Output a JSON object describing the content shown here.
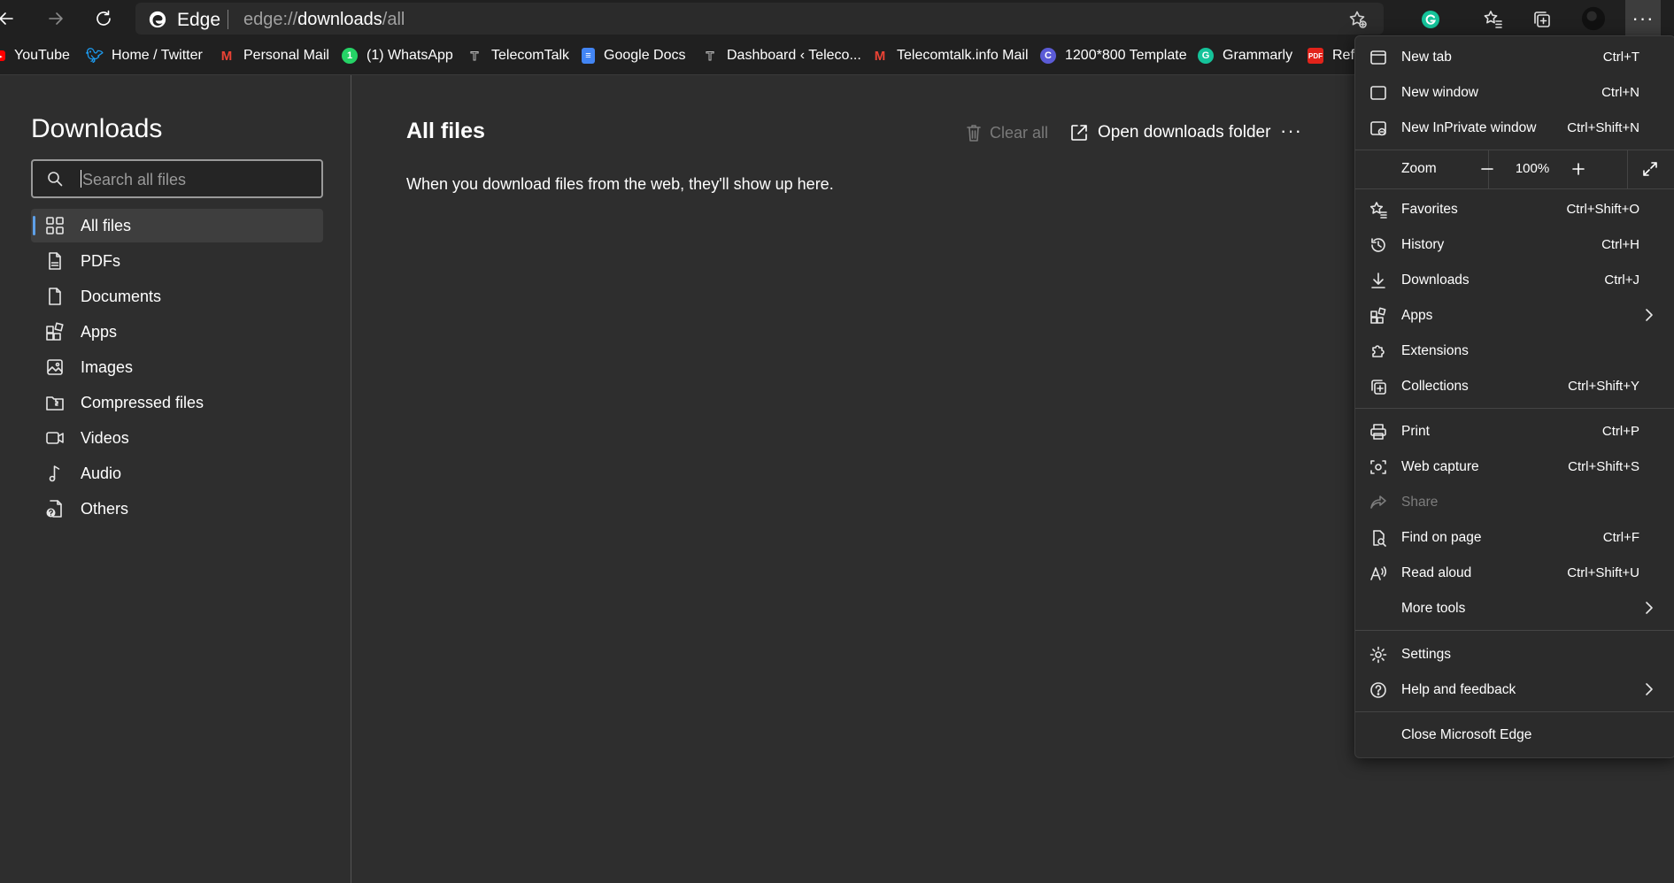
{
  "browser": {
    "name": "Edge",
    "url_prefix": "edge://",
    "url_main": "downloads",
    "url_suffix": "/all",
    "menu_button": "···"
  },
  "bookmarks": [
    {
      "label": "YouTube",
      "icon": "youtube-icon",
      "color": "#ff0000"
    },
    {
      "label": "Home / Twitter",
      "icon": "twitter-icon",
      "color": "#1d9bf0"
    },
    {
      "label": "Personal Mail",
      "icon": "gmail-icon",
      "color": "#ea4335"
    },
    {
      "label": "(1) WhatsApp",
      "icon": "whatsapp-icon",
      "color": "#25d366"
    },
    {
      "label": "TelecomTalk",
      "icon": "telecomtalk-icon",
      "color": "#000000"
    },
    {
      "label": "Google Docs",
      "icon": "google-docs-icon",
      "color": "#4285f4"
    },
    {
      "label": "Dashboard ‹ Teleco...",
      "icon": "telecomtalk-icon",
      "color": "#000000"
    },
    {
      "label": "Telecomtalk.info Mail",
      "icon": "gmail-icon",
      "color": "#ea4335"
    },
    {
      "label": "1200*800 Template",
      "icon": "canva-icon",
      "color": "#5b5bd6"
    },
    {
      "label": "Grammarly",
      "icon": "grammarly-icon",
      "color": "#15c39a"
    },
    {
      "label": "Refe",
      "icon": "pdf-icon",
      "color": "#e2231a"
    }
  ],
  "sidebar": {
    "title": "Downloads",
    "search_placeholder": "Search all files",
    "items": [
      {
        "label": "All files",
        "icon": "grid-icon"
      },
      {
        "label": "PDFs",
        "icon": "pdf-file-icon"
      },
      {
        "label": "Documents",
        "icon": "document-icon"
      },
      {
        "label": "Apps",
        "icon": "apps-icon"
      },
      {
        "label": "Images",
        "icon": "image-icon"
      },
      {
        "label": "Compressed files",
        "icon": "archive-icon"
      },
      {
        "label": "Videos",
        "icon": "video-icon"
      },
      {
        "label": "Audio",
        "icon": "music-note-icon"
      },
      {
        "label": "Others",
        "icon": "unknown-file-icon"
      }
    ]
  },
  "main": {
    "title": "All files",
    "clear_all": "Clear all",
    "open_folder": "Open downloads folder",
    "more": "···",
    "empty_message": "When you download files from the web, they'll show up here."
  },
  "menu": {
    "new_tab": {
      "label": "New tab",
      "shortcut": "Ctrl+T"
    },
    "new_window": {
      "label": "New window",
      "shortcut": "Ctrl+N"
    },
    "new_inprivate": {
      "label": "New InPrivate window",
      "shortcut": "Ctrl+Shift+N"
    },
    "zoom": {
      "label": "Zoom",
      "value": "100%"
    },
    "favorites": {
      "label": "Favorites",
      "shortcut": "Ctrl+Shift+O"
    },
    "history": {
      "label": "History",
      "shortcut": "Ctrl+H"
    },
    "downloads": {
      "label": "Downloads",
      "shortcut": "Ctrl+J"
    },
    "apps": {
      "label": "Apps"
    },
    "extensions": {
      "label": "Extensions"
    },
    "collections": {
      "label": "Collections",
      "shortcut": "Ctrl+Shift+Y"
    },
    "print": {
      "label": "Print",
      "shortcut": "Ctrl+P"
    },
    "web_capture": {
      "label": "Web capture",
      "shortcut": "Ctrl+Shift+S"
    },
    "share": {
      "label": "Share"
    },
    "find_on_page": {
      "label": "Find on page",
      "shortcut": "Ctrl+F"
    },
    "read_aloud": {
      "label": "Read aloud",
      "shortcut": "Ctrl+Shift+U"
    },
    "more_tools": {
      "label": "More tools"
    },
    "settings": {
      "label": "Settings"
    },
    "help": {
      "label": "Help and feedback"
    },
    "close": {
      "label": "Close Microsoft Edge"
    }
  },
  "colors": {
    "accent": "#5ea0e8",
    "background": "#2e2e2e",
    "toolbar": "#202020",
    "menu": "#2b2b2b"
  }
}
